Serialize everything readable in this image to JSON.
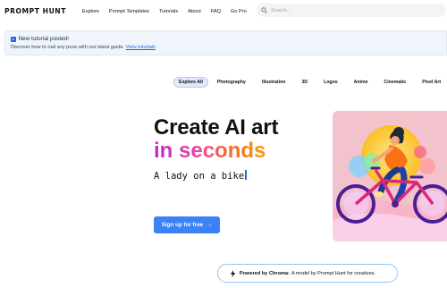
{
  "brand": {
    "name": "PROMPT HUNT"
  },
  "nav": {
    "items": [
      "Explore",
      "Prompt Templates",
      "Tutorials",
      "About",
      "FAQ",
      "Go Pro"
    ]
  },
  "search": {
    "placeholder": "Search..."
  },
  "banner": {
    "title": "New tutorial posted!",
    "body": "Discover how to nail any pose with our latest guide.",
    "link": "View tutorials"
  },
  "filters": {
    "items": [
      "Explore All",
      "Photography",
      "Illustration",
      "3D",
      "Logos",
      "Anime",
      "Cinematic",
      "Pixel Art"
    ],
    "active": "Explore All"
  },
  "hero": {
    "line1": "Create AI art",
    "line2": "in seconds",
    "typed_text": "A lady on a bike",
    "cta_label": "Sign up for free",
    "cta_arrow": "→"
  },
  "powered": {
    "prefix": "Powered by Chroma:",
    "suffix": "A model by Prompt Hunt for creatives."
  },
  "colors": {
    "accent": "#3b82f6",
    "gradient": [
      "#c026d3",
      "#ec4899",
      "#f97316",
      "#f59e0b"
    ],
    "art_background": "#f2c2cd"
  }
}
